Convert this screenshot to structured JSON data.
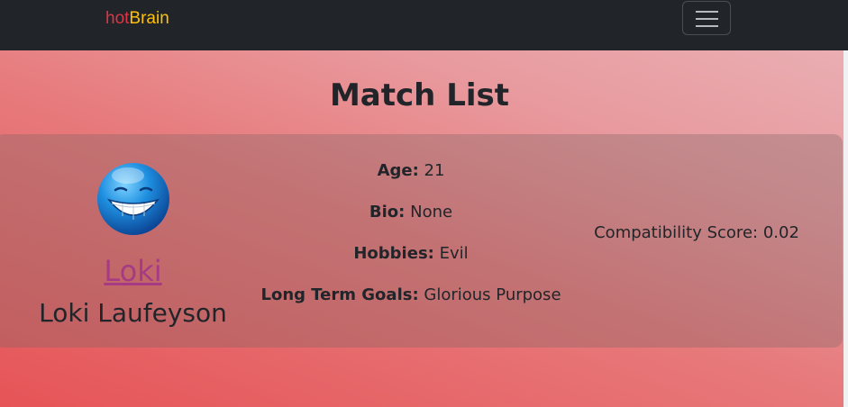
{
  "navbar": {
    "brand_hot": "hot",
    "brand_brain": "Brain",
    "toggler_icon": "hamburger-menu-icon"
  },
  "page": {
    "title": "Match List"
  },
  "match": {
    "avatar_icon": "grinning-blue-smiley-icon",
    "username": "Loki",
    "full_name": "Loki Laufeyson",
    "age_label": "Age:",
    "age": "21",
    "bio_label": "Bio:",
    "bio": "None",
    "hobbies_label": "Hobbies:",
    "hobbies": "Evil",
    "goals_label": "Long Term Goals:",
    "goals": "Glorious Purpose",
    "score_label": "Compatibility Score:",
    "score": "0.02"
  },
  "colors": {
    "navbar_bg": "#212529",
    "brand_hot": "#dc3545",
    "brand_brain": "#ffc107",
    "link": "#a73a84"
  }
}
